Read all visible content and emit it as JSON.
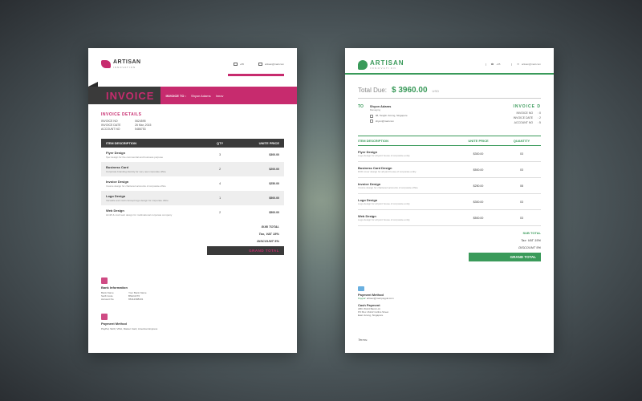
{
  "left": {
    "brand": "ARTISAN",
    "brand_sub": "INNOVATION",
    "contact": {
      "phone": "+65",
      "email": "artisan@mail.com"
    },
    "invoice_label": "INVOICE",
    "to_label": "INVOICE TO :",
    "to_name": "Shyon Adams",
    "to_extra": "Innov",
    "details_title": "INVOICE  DETAILS",
    "details": [
      {
        "k": "INVOICE NO",
        "v": "0624595"
      },
      {
        "k": "INVOICE DATE",
        "v": "26 Mar, 2015"
      },
      {
        "k": "ACCOUNT NO",
        "v": "5486753"
      }
    ],
    "cols": {
      "desc": "ITEM DESCRIPTION",
      "qty": "QTY",
      "price": "UNITE PRICE"
    },
    "items": [
      {
        "name": "Flyer Design",
        "desc": "flyer design for the commercial and business purpose",
        "qty": "3",
        "price": "$300.00"
      },
      {
        "name": "Business Card",
        "desc": "Corporate branding identity for very new corporate office",
        "qty": "2",
        "price": "$200.00"
      },
      {
        "name": "Invoice Design",
        "desc": "Invoice design for chartered accounts of corporate office",
        "qty": "4",
        "price": "$250.00"
      },
      {
        "name": "Logo Design",
        "desc": "Versatile and multi concept logo design for corporate office",
        "qty": "1",
        "price": "$500.00"
      },
      {
        "name": "Web Design",
        "desc": "Html5 & css3 web design for multinational corporate company",
        "qty": "2",
        "price": "$500.00"
      }
    ],
    "subtotal_label": "SUB TOTAL",
    "tax_label": "Tax, VAT 15%",
    "discount_label": "DISCOUNT 5%",
    "grand_label": "GRAND TOTAL",
    "bank_title": "Bank Information",
    "bank": [
      {
        "k": "Bank Name",
        "v": "Your Bank Name"
      },
      {
        "k": "Swift Code",
        "v": "BNHGKT0"
      },
      {
        "k": "Account No",
        "v": "65412398431"
      }
    ],
    "pay_title": "Payment Method",
    "pay_text": "PayPal, Skrill, VISA, Master Card, American Express"
  },
  "right": {
    "brand": "ARTISAN",
    "brand_sub": "INNOVATION",
    "contact": {
      "phone": "+65",
      "email": "artisan@mail.com"
    },
    "total_label": "Total Due:",
    "total_amount": "$ 3960.00",
    "total_currency": "USD",
    "to_label": "TO",
    "to_name": "Shyon Adams",
    "to_sub": "Managing",
    "to_addr": "98, Tanglin Jurong, Singapore",
    "to_email": "shyon@mail.com",
    "meta_title": "INVOICE D",
    "meta": [
      {
        "k": "INVOICE NO",
        "v": ": 0"
      },
      {
        "k": "INVOICE DATE",
        "v": ": 2"
      },
      {
        "k": "ACCOUNT NO",
        "v": ": 5"
      }
    ],
    "cols": {
      "desc": "ITEM DESCRIPTION",
      "price": "UNITE PRICE",
      "qty": "QUANTITY"
    },
    "items": [
      {
        "name": "Flyer Design",
        "desc": "Logo design for all joint house of corporate entity",
        "price": "$300.00",
        "qty": "03"
      },
      {
        "name": "Business Card Design",
        "desc": "DVD cover design for all joint house of corporate entity",
        "price": "$500.00",
        "qty": "03"
      },
      {
        "name": "Invoice Design",
        "desc": "Invoice design for chartered accounts of corporate office",
        "price": "$250.00",
        "qty": "08"
      },
      {
        "name": "Logo Design",
        "desc": "Logo design for all joint house of corporate entity",
        "price": "$300.00",
        "qty": "03"
      },
      {
        "name": "Web Design",
        "desc": "Logo design for all joint house of corporate entity",
        "price": "$500.00",
        "qty": "03"
      }
    ],
    "subtotal_label": "SUB TOTAL",
    "tax_label": "Tax: VAT 15%",
    "discount_label": "DISCOUNT 5%",
    "grand_label": "GRAND TOTAL",
    "pay_title": "Payment Method",
    "paypal_label": "Paypal:",
    "paypal_value": "artisan@mail.paypal.com",
    "cash_title": "Cash Payment",
    "cash_lines": [
      "ABC World Bank Ltd.",
      "PO Box 16122 Collins Street",
      "East Jurong, Singapore"
    ],
    "terms_label": "Terms:"
  }
}
